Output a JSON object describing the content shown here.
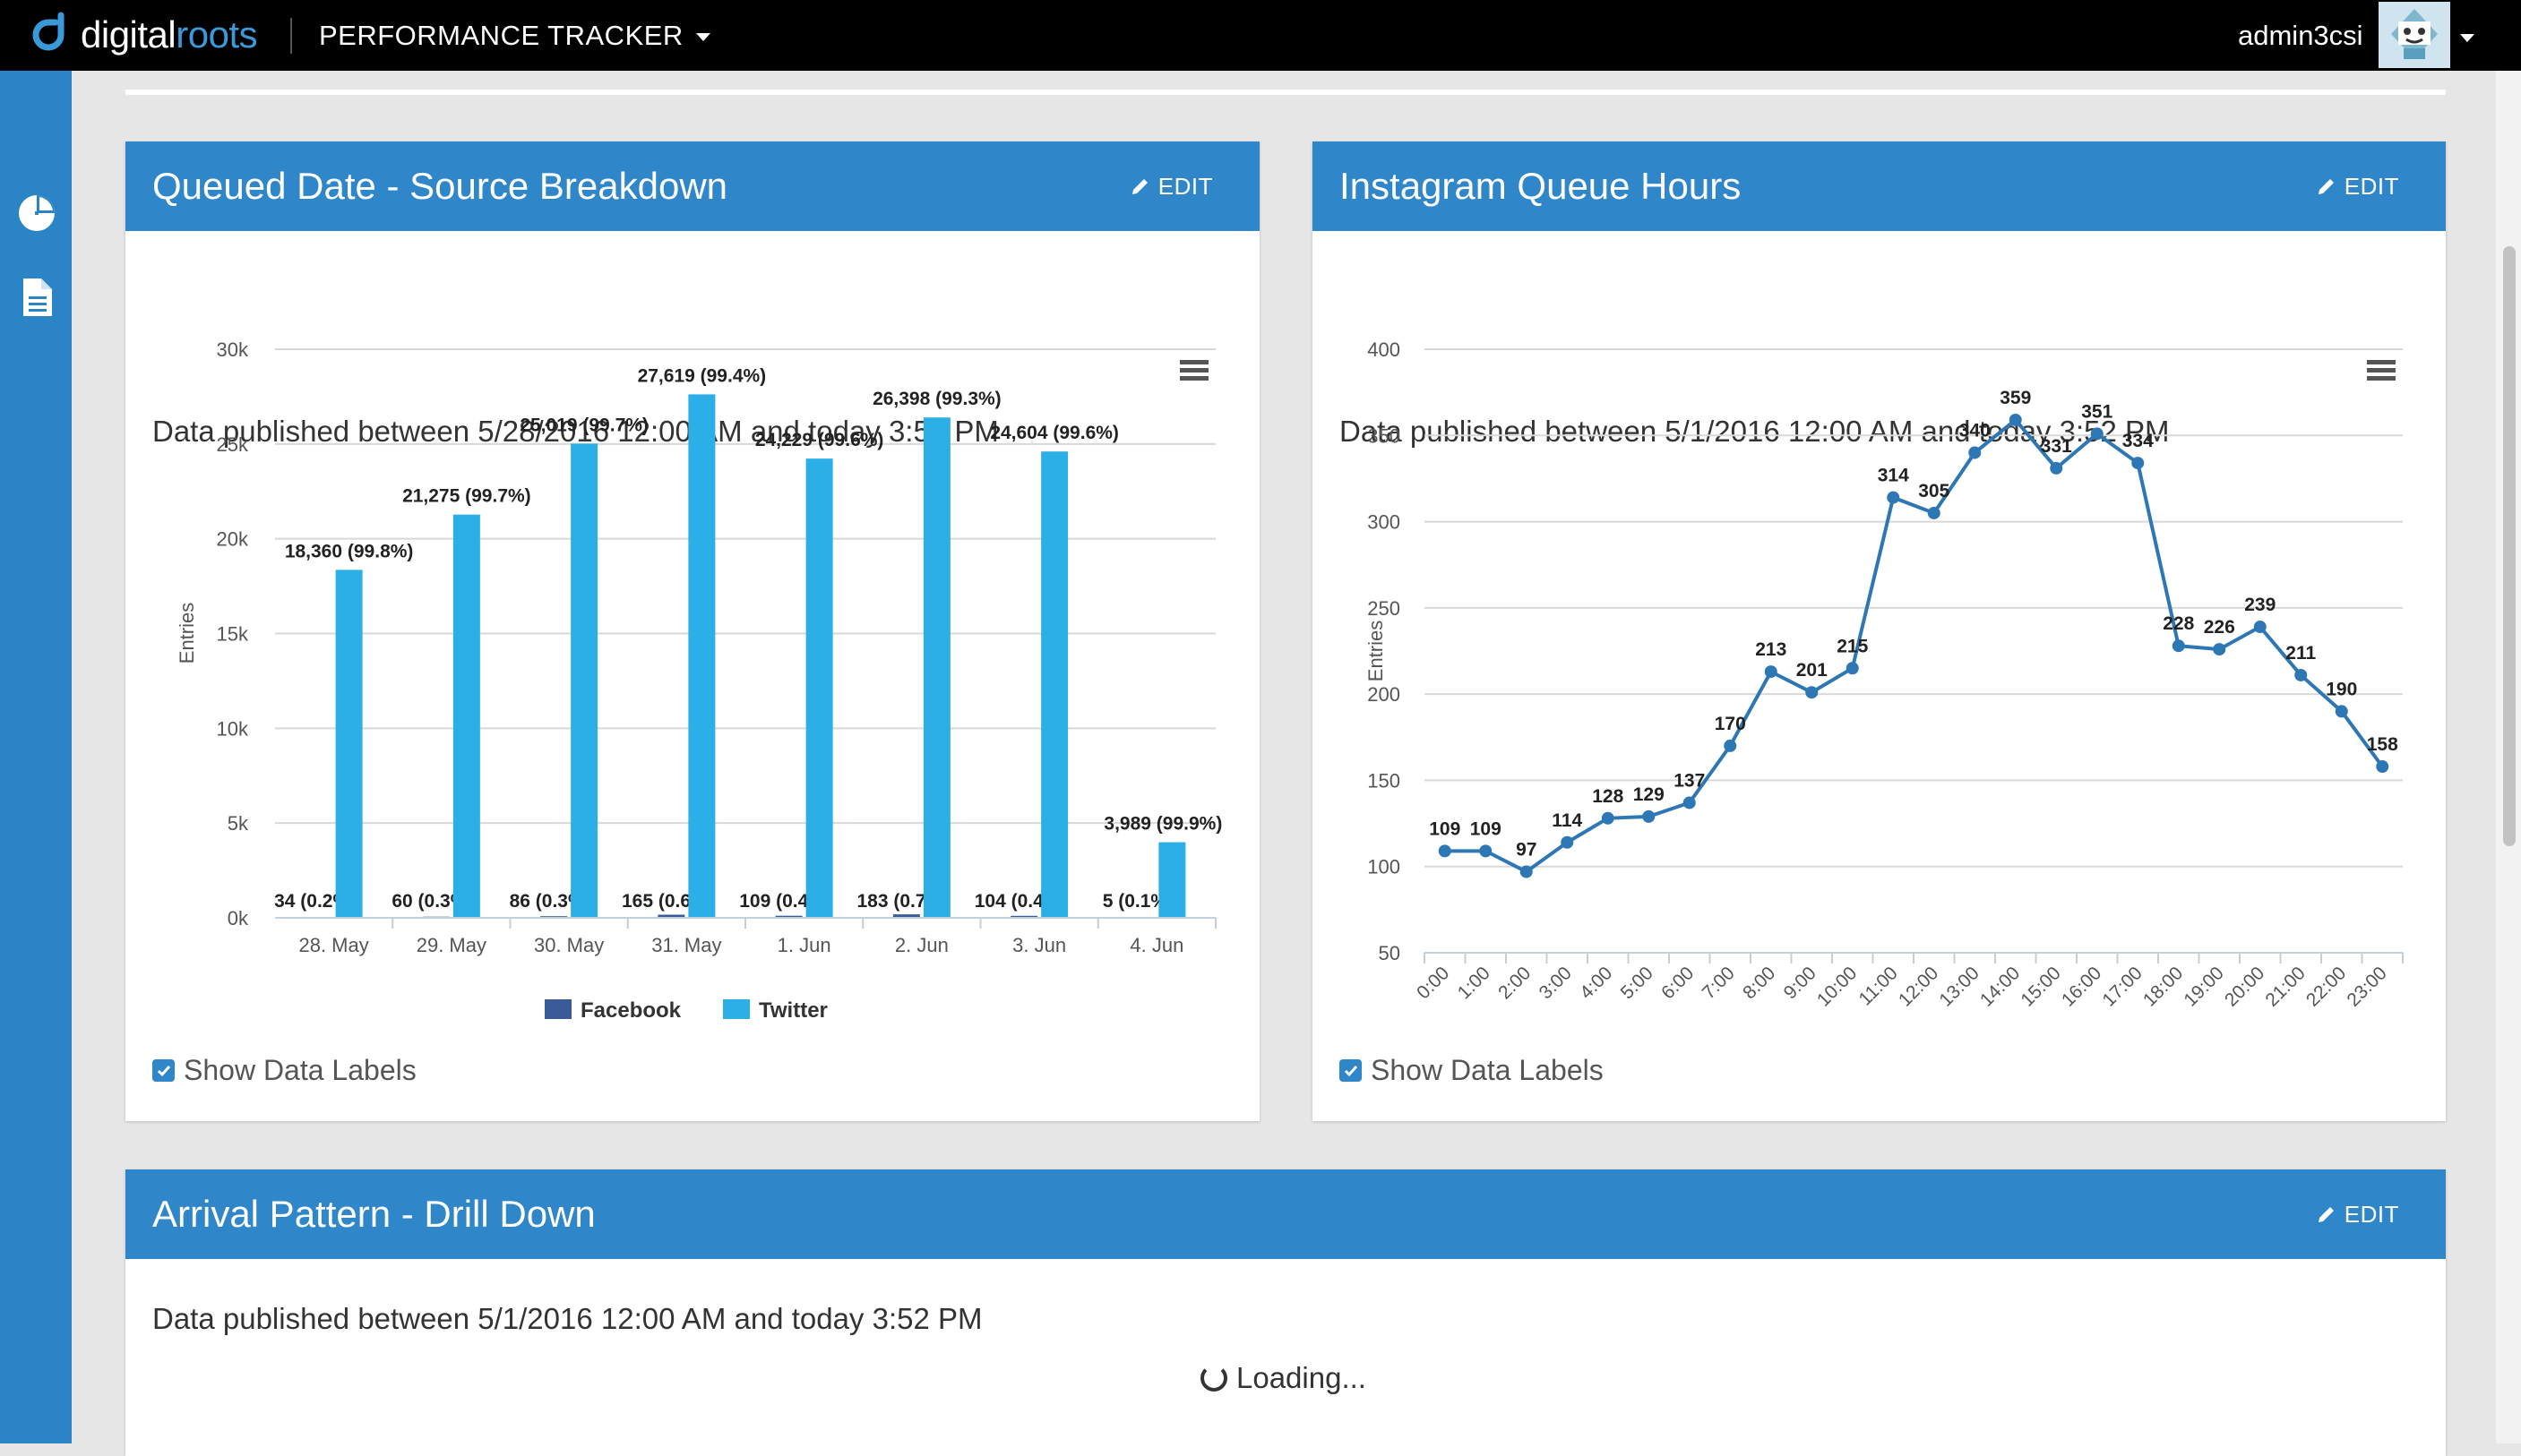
{
  "header": {
    "brand": {
      "part1": "digital",
      "part2": "roots"
    },
    "app_menu_label": "PERFORMANCE TRACKER",
    "username": "admin3csi"
  },
  "sidebar": {
    "items": [
      {
        "icon": "pie-chart-icon"
      },
      {
        "icon": "document-icon"
      }
    ]
  },
  "colors": {
    "header_blue": "#2f86c8",
    "sidebar_blue": "#2b84c6",
    "twitter": "#2caee6",
    "facebook": "#3a5a98",
    "line": "#2e77b5"
  },
  "panels": {
    "source_breakdown": {
      "title": "Queued Date - Source Breakdown",
      "edit_label": "EDIT",
      "published_text": "Data published between 5/28/2016 12:00 AM and today 3:52 PM",
      "show_labels_text": "Show Data Labels"
    },
    "instagram": {
      "title": "Instagram Queue Hours",
      "edit_label": "EDIT",
      "published_text": "Data published between 5/1/2016 12:00 AM and today 3:52 PM",
      "show_labels_text": "Show Data Labels"
    },
    "arrival": {
      "title": "Arrival Pattern - Drill Down",
      "edit_label": "EDIT",
      "published_text": "Data published between 5/1/2016 12:00 AM and today 3:52 PM",
      "loading_text": "Loading..."
    }
  },
  "chart_data": [
    {
      "type": "bar",
      "title": "",
      "xlabel": "",
      "ylabel": "Entries",
      "ylim": [
        0,
        30000
      ],
      "yticks": [
        "0k",
        "5k",
        "10k",
        "15k",
        "20k",
        "25k",
        "30k"
      ],
      "categories": [
        "28. May",
        "29. May",
        "30. May",
        "31. May",
        "1. Jun",
        "2. Jun",
        "3. Jun",
        "4. Jun"
      ],
      "series": [
        {
          "name": "Facebook",
          "color": "#3a5a98",
          "values": [
            34,
            60,
            86,
            165,
            109,
            183,
            104,
            5
          ],
          "labels": [
            "34 (0.2%)",
            "60 (0.3%)",
            "86 (0.3%)",
            "165 (0.6%)",
            "109 (0.4%)",
            "183 (0.7%)",
            "104 (0.4%)",
            "5 (0.1%)"
          ]
        },
        {
          "name": "Twitter",
          "color": "#2caee6",
          "values": [
            18360,
            21275,
            25019,
            27619,
            24229,
            26398,
            24604,
            3989
          ],
          "labels": [
            "18,360 (99.8%)",
            "21,275 (99.7%)",
            "25,019 (99.7%)",
            "27,619 (99.4%)",
            "24,229 (99.6%)",
            "26,398 (99.3%)",
            "24,604 (99.6%)",
            "3,989 (99.9%)"
          ]
        }
      ],
      "legend": "bottom-center",
      "grid": true
    },
    {
      "type": "line",
      "title": "",
      "xlabel": "",
      "ylabel": "Entries",
      "ylim": [
        50,
        400
      ],
      "yticks": [
        "50",
        "100",
        "150",
        "200",
        "250",
        "300",
        "350",
        "400"
      ],
      "x": [
        "0:00",
        "1:00",
        "2:00",
        "3:00",
        "4:00",
        "5:00",
        "6:00",
        "7:00",
        "8:00",
        "9:00",
        "10:00",
        "11:00",
        "12:00",
        "13:00",
        "14:00",
        "15:00",
        "16:00",
        "17:00",
        "18:00",
        "19:00",
        "20:00",
        "21:00",
        "22:00",
        "23:00"
      ],
      "values": [
        109,
        109,
        97,
        114,
        128,
        129,
        137,
        170,
        213,
        201,
        215,
        314,
        305,
        340,
        359,
        331,
        351,
        334,
        228,
        226,
        239,
        211,
        190,
        158
      ],
      "grid": true
    }
  ]
}
